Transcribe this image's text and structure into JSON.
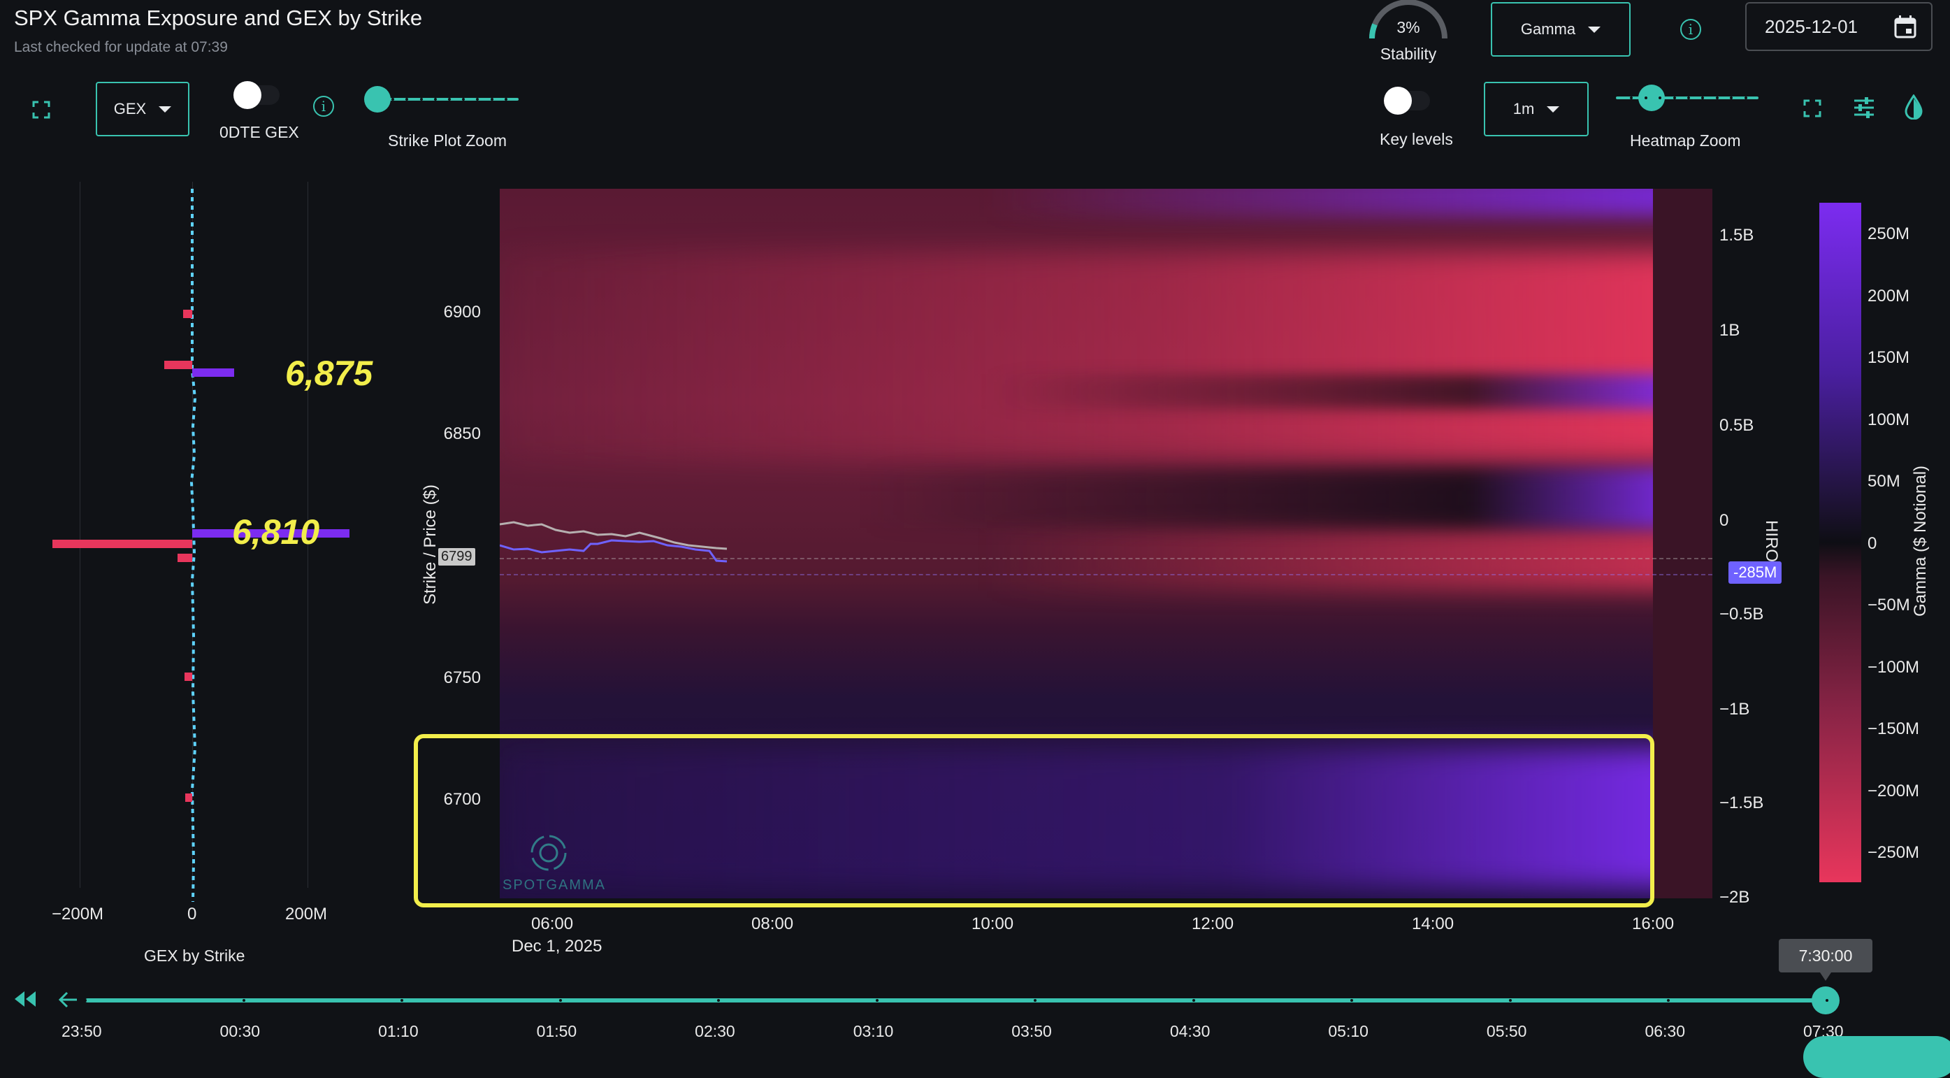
{
  "header": {
    "title": "SPX Gamma Exposure and GEX by Strike",
    "subtitle": "Last checked for update at 07:39"
  },
  "stability": {
    "value": "3%",
    "label": "Stability"
  },
  "controls": {
    "metric_select": "Gamma",
    "date": "2025-12-01",
    "gex_select": "GEX",
    "odte_label": "0DTE GEX",
    "strike_zoom_label": "Strike Plot Zoom",
    "key_levels_label": "Key levels",
    "interval_select": "1m",
    "heatmap_zoom_label": "Heatmap Zoom",
    "strike_zoom_level": 0.0,
    "heatmap_zoom_level": 0.25
  },
  "gex_panel": {
    "xticks": [
      "−200M",
      "0",
      "200M"
    ],
    "xlabel": "GEX by Strike",
    "levels": [
      "6,875",
      "6,810"
    ]
  },
  "chart_data": {
    "type": "heatmap",
    "ylabel": "Strike / Price ($)",
    "yticks": [
      "6900",
      "6850",
      "6750",
      "6700"
    ],
    "price_marker": "6799",
    "xticks": [
      "06:00",
      "08:00",
      "10:00",
      "12:00",
      "14:00",
      "16:00"
    ],
    "x_date": "Dec 1, 2025",
    "hiro_label": "HIRO",
    "hiro_ticks": [
      "1.5B",
      "1B",
      "0.5B",
      "0",
      "−0.5B",
      "−1B",
      "−1.5B",
      "−2B"
    ],
    "hiro_current": "-285M",
    "colorbar_label": "Gamma ($ Notional)",
    "colorbar_ticks": [
      "250M",
      "200M",
      "150M",
      "100M",
      "50M",
      "0",
      "−50M",
      "−100M",
      "−150M",
      "−200M",
      "−250M"
    ]
  },
  "timeline": {
    "ticks": [
      "23:50",
      "00:30",
      "01:10",
      "01:50",
      "02:30",
      "03:10",
      "03:50",
      "04:30",
      "05:10",
      "05:50",
      "06:30",
      "07:30"
    ],
    "current": "7:30:00"
  },
  "watermark": "SPOTGAMMA",
  "colors": {
    "accent": "#39c3b0",
    "positive": "#7c2cf0",
    "negative": "#e8365c",
    "highlight": "#f2ee4b"
  }
}
